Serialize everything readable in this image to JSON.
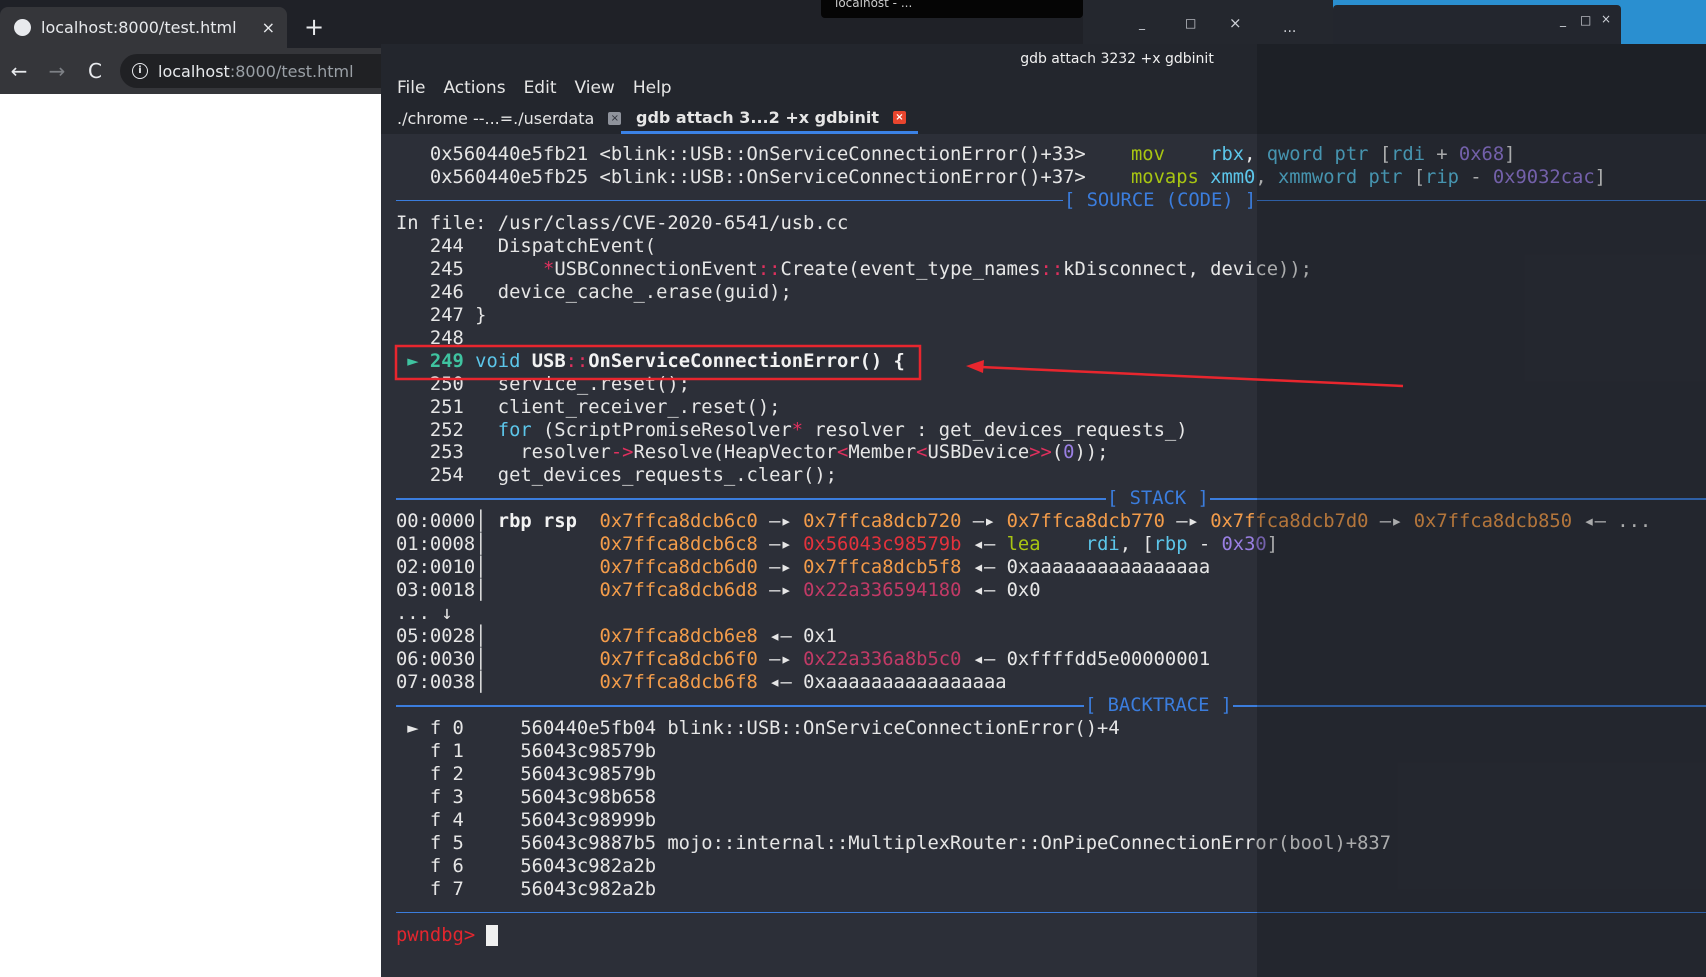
{
  "browser": {
    "tab_title": "localhost:8000/test.html",
    "tab_close": "×",
    "new_tab": "+",
    "back": "←",
    "forward": "→",
    "reload": "C",
    "url_host": "localhost",
    "url_rest": ":8000/test.html",
    "info": "i"
  },
  "desktop": {
    "tooltip": "localhost - ...",
    "other_controls": [
      "_",
      "□",
      "×"
    ],
    "menu_dots": "..."
  },
  "terminal": {
    "title": "gdb attach 3232 +x gdbinit",
    "window_controls": [
      "_",
      "□",
      "×"
    ],
    "menu": [
      "File",
      "Actions",
      "Edit",
      "View",
      "Help"
    ],
    "tabs": [
      {
        "label": "./chrome --...=./userdata",
        "close": "×",
        "active": false
      },
      {
        "label": "gdb attach 3...2 +x gdbinit",
        "close": "×",
        "active": true
      }
    ],
    "lines": [
      {
        "s": [
          [
            "   0x560440e5fb21 <blink::USB::OnServiceConnectionError()+33>    ",
            "w"
          ],
          [
            "mov",
            "g"
          ],
          [
            "    ",
            "w"
          ],
          [
            "rbx",
            "c"
          ],
          [
            ", ",
            "w"
          ],
          [
            "qword ptr",
            "c"
          ],
          [
            " [",
            "w"
          ],
          [
            "rdi",
            "c"
          ],
          [
            " + ",
            "w"
          ],
          [
            "0x68",
            "p"
          ],
          [
            "]",
            "w"
          ]
        ]
      },
      {
        "s": [
          [
            "   0x560440e5fb25 <blink::USB::OnServiceConnectionError()+37>    ",
            "w"
          ],
          [
            "movaps",
            "g"
          ],
          [
            " ",
            "w"
          ],
          [
            "xmm0",
            "c"
          ],
          [
            ", ",
            "w"
          ],
          [
            "xmmword ptr",
            "c"
          ],
          [
            " [",
            "w"
          ],
          [
            "rip",
            "c"
          ],
          [
            " - ",
            "w"
          ],
          [
            "0x9032cac",
            "p"
          ],
          [
            "]",
            "w"
          ]
        ]
      },
      {
        "d": "[ SOURCE (CODE) ]",
        "pos": "source"
      },
      {
        "s": [
          [
            "In file: /usr/class/CVE-2020-6541/usb.cc",
            "w"
          ]
        ]
      },
      {
        "s": [
          [
            "   244   DispatchEvent(",
            "w"
          ]
        ]
      },
      {
        "s": [
          [
            "   245       ",
            "w"
          ],
          [
            "*",
            "k"
          ],
          [
            "USBConnectionEvent",
            "w"
          ],
          [
            "::",
            "k"
          ],
          [
            "Create(event_type_names",
            "w"
          ],
          [
            "::",
            "k"
          ],
          [
            "kDisconnect, device));",
            "w"
          ]
        ]
      },
      {
        "s": [
          [
            "   246   device_cache_.erase(guid);",
            "w"
          ]
        ]
      },
      {
        "s": [
          [
            "   247 }",
            "w"
          ]
        ]
      },
      {
        "s": [
          [
            "   248",
            "w"
          ]
        ]
      },
      {
        "s": [
          [
            " ► ",
            "t"
          ],
          [
            "249",
            "t"
          ],
          [
            " ",
            "w"
          ],
          [
            "void",
            "c"
          ],
          [
            " ",
            "w"
          ],
          [
            "USB",
            "b"
          ],
          [
            "::",
            "k"
          ],
          [
            "OnServiceConnectionError() {",
            "b"
          ]
        ]
      },
      {
        "s": [
          [
            "   250   service_.reset();",
            "w"
          ]
        ]
      },
      {
        "s": [
          [
            "   251   client_receiver_.reset();",
            "w"
          ]
        ]
      },
      {
        "s": [
          [
            "   252   ",
            "w"
          ],
          [
            "for",
            "c"
          ],
          [
            " (ScriptPromiseResolver",
            "w"
          ],
          [
            "*",
            "k"
          ],
          [
            " resolver : get_devices_requests_)",
            "w"
          ]
        ]
      },
      {
        "s": [
          [
            "   253     resolver",
            "w"
          ],
          [
            "->",
            "k"
          ],
          [
            "Resolve(HeapVector",
            "w"
          ],
          [
            "<",
            "k"
          ],
          [
            "Member",
            "w"
          ],
          [
            "<",
            "k"
          ],
          [
            "USBDevice",
            "w"
          ],
          [
            ">>",
            "k"
          ],
          [
            "(",
            "w"
          ],
          [
            "0",
            "p"
          ],
          [
            "));",
            "w"
          ]
        ]
      },
      {
        "s": [
          [
            "   254   get_devices_requests_.clear();",
            "w"
          ]
        ]
      },
      {
        "d": "[ STACK ]",
        "pos": "stack"
      },
      {
        "s": [
          [
            "00:0000│ ",
            "w"
          ],
          [
            "rbp rsp",
            "b"
          ],
          [
            "  ",
            "w"
          ],
          [
            "0x7ffca8dcb6c0",
            "o"
          ],
          [
            " —▸ ",
            "w"
          ],
          [
            "0x7ffca8dcb720",
            "o"
          ],
          [
            " —▸ ",
            "w"
          ],
          [
            "0x7ffca8dcb770",
            "o"
          ],
          [
            " —▸ ",
            "w"
          ],
          [
            "0x7ffca8dcb7d0",
            "o"
          ],
          [
            " —▸ ",
            "w"
          ],
          [
            "0x7ffca8dcb850",
            "o"
          ],
          [
            " ◂— ...",
            "w"
          ]
        ]
      },
      {
        "s": [
          [
            "01:0008│          ",
            "w"
          ],
          [
            "0x7ffca8dcb6c8",
            "o"
          ],
          [
            " —▸ ",
            "w"
          ],
          [
            "0x56043c98579b",
            "r"
          ],
          [
            " ◂— ",
            "w"
          ],
          [
            "lea",
            "g"
          ],
          [
            "    ",
            "w"
          ],
          [
            "rdi",
            "c"
          ],
          [
            ", [",
            "w"
          ],
          [
            "rbp",
            "c"
          ],
          [
            " - ",
            "w"
          ],
          [
            "0x30",
            "p"
          ],
          [
            "]",
            "w"
          ]
        ]
      },
      {
        "s": [
          [
            "02:0010│          ",
            "w"
          ],
          [
            "0x7ffca8dcb6d0",
            "o"
          ],
          [
            " —▸ ",
            "w"
          ],
          [
            "0x7ffca8dcb5f8",
            "o"
          ],
          [
            " ◂— 0xaaaaaaaaaaaaaaaa",
            "w"
          ]
        ]
      },
      {
        "s": [
          [
            "03:0018│          ",
            "w"
          ],
          [
            "0x7ffca8dcb6d8",
            "o"
          ],
          [
            " —▸ ",
            "w"
          ],
          [
            "0x22a336594180",
            "m"
          ],
          [
            " ◂— 0x0",
            "w"
          ]
        ]
      },
      {
        "s": [
          [
            "... ↓",
            "w"
          ]
        ]
      },
      {
        "s": [
          [
            "05:0028│          ",
            "w"
          ],
          [
            "0x7ffca8dcb6e8",
            "o"
          ],
          [
            " ◂— 0x1",
            "w"
          ]
        ]
      },
      {
        "s": [
          [
            "06:0030│          ",
            "w"
          ],
          [
            "0x7ffca8dcb6f0",
            "o"
          ],
          [
            " —▸ ",
            "w"
          ],
          [
            "0x22a336a8b5c0",
            "m"
          ],
          [
            " ◂— 0xffffdd5e00000001",
            "w"
          ]
        ]
      },
      {
        "s": [
          [
            "07:0038│          ",
            "w"
          ],
          [
            "0x7ffca8dcb6f8",
            "o"
          ],
          [
            " ◂— 0xaaaaaaaaaaaaaaaa",
            "w"
          ]
        ]
      },
      {
        "d": "[ BACKTRACE ]",
        "pos": "backtrace"
      },
      {
        "s": [
          [
            " ► ",
            "w"
          ],
          [
            "f 0     560440e5fb04 blink::USB::OnServiceConnectionError()+4",
            "w"
          ]
        ]
      },
      {
        "s": [
          [
            "   f 1     56043c98579b",
            "w"
          ]
        ]
      },
      {
        "s": [
          [
            "   f 2     56043c98579b",
            "w"
          ]
        ]
      },
      {
        "s": [
          [
            "   f 3     56043c98b658",
            "w"
          ]
        ]
      },
      {
        "s": [
          [
            "   f 4     56043c98999b",
            "w"
          ]
        ]
      },
      {
        "s": [
          [
            "   f 5     56043c9887b5 mojo::internal::MultiplexRouter::OnPipeConnectionError(bool)+837",
            "w"
          ]
        ]
      },
      {
        "s": [
          [
            "   f 6     56043c982a2b",
            "w"
          ]
        ]
      },
      {
        "s": [
          [
            "   f 7     56043c982a2b",
            "w"
          ]
        ]
      },
      {
        "d": "",
        "pos": "end"
      },
      {
        "s": [
          [
            "pwndbg> ",
            "pr"
          ],
          [
            " ",
            "cur"
          ]
        ]
      }
    ]
  },
  "colors": {
    "accent_blue": "#3b7ddd",
    "annotation_red": "#e8262e",
    "terminal_bg": "#2c2f38"
  }
}
